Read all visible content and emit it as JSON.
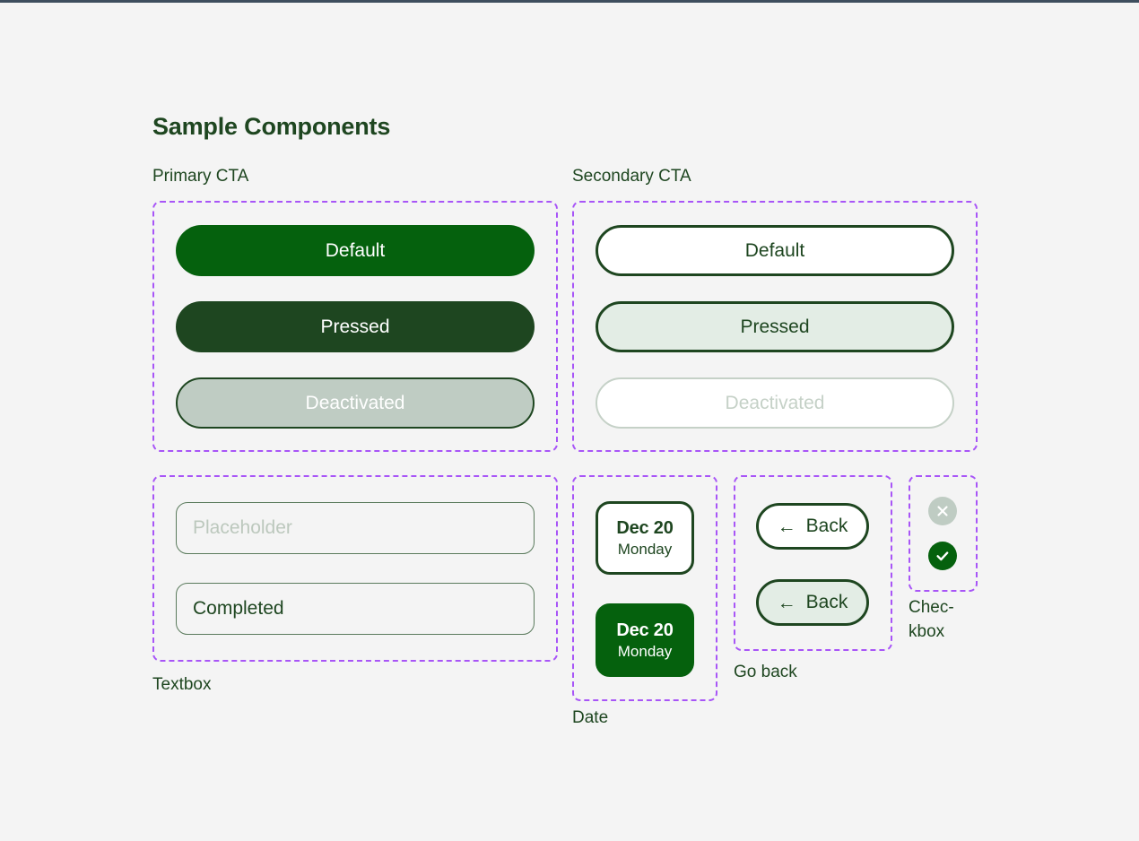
{
  "page": {
    "title": "Sample Components",
    "background_color": "#f4f4f4",
    "accent_green": "#05610d",
    "dark_green": "#1e4620",
    "annotation_purple": "#a855f7"
  },
  "groups": {
    "primary_cta": {
      "label": "Primary CTA",
      "buttons": [
        {
          "label": "Default",
          "state": "default"
        },
        {
          "label": "Pressed",
          "state": "pressed"
        },
        {
          "label": "Deactivated",
          "state": "deactivated"
        }
      ]
    },
    "secondary_cta": {
      "label": "Secondary CTA",
      "buttons": [
        {
          "label": "Default",
          "state": "default"
        },
        {
          "label": "Pressed",
          "state": "pressed"
        },
        {
          "label": "Deactivated",
          "state": "deactivated"
        }
      ]
    },
    "textbox": {
      "label": "Textbox",
      "fields": [
        {
          "value": "",
          "placeholder": "Placeholder",
          "state": "empty"
        },
        {
          "value": "Completed",
          "placeholder": "",
          "state": "completed"
        }
      ]
    },
    "date": {
      "label": "Date",
      "cards": [
        {
          "day": "Dec 20",
          "weekday": "Monday",
          "state": "default"
        },
        {
          "day": "Dec 20",
          "weekday": "Monday",
          "state": "selected"
        }
      ]
    },
    "go_back": {
      "label": "Go back",
      "buttons": [
        {
          "label": "Back",
          "icon": "arrow-left-icon",
          "arrow": "←",
          "state": "default"
        },
        {
          "label": "Back",
          "icon": "arrow-left-icon",
          "arrow": "←",
          "state": "pressed"
        }
      ]
    },
    "checkbox": {
      "label": "Chec-kbox",
      "items": [
        {
          "icon": "close-circle-icon",
          "state": "unchecked",
          "color": "#bfccc3"
        },
        {
          "icon": "check-circle-icon",
          "state": "checked",
          "color": "#05610d"
        }
      ]
    }
  }
}
